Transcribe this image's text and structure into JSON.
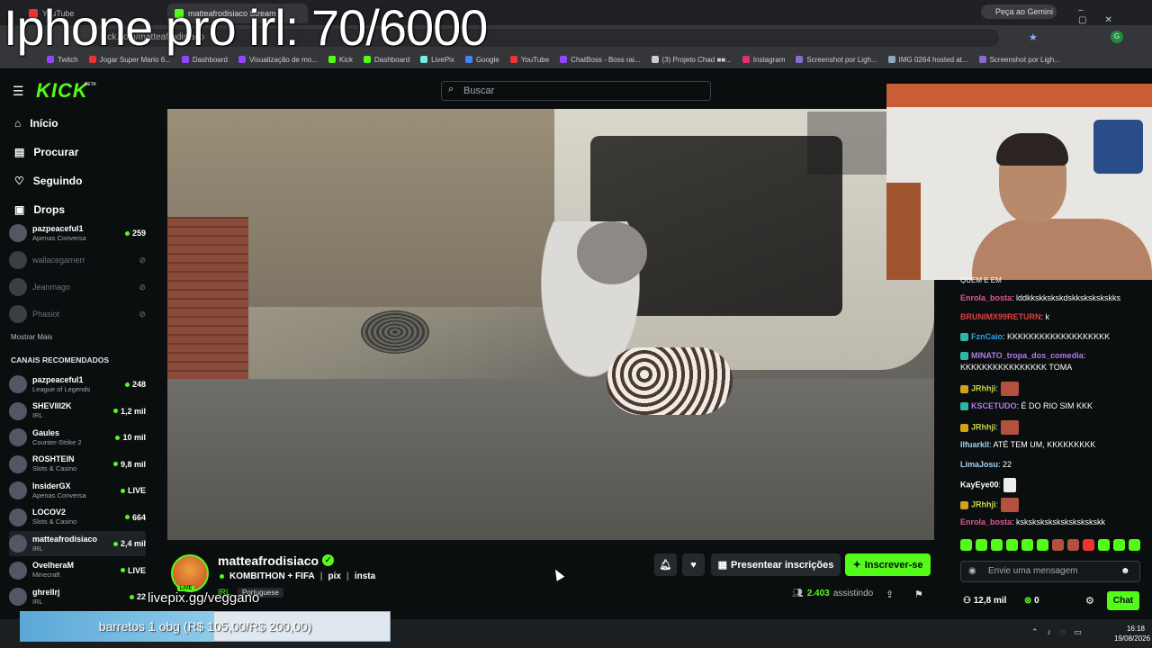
{
  "overlay": {
    "title": "Iphone pro irl: 70/6000",
    "livepix": "livepix.gg/veggano",
    "goal": "barretos 1 obg (R$ 105,00/R$ 200,00)",
    "goal_progress": 0.525
  },
  "browser": {
    "tabs": [
      {
        "label": "YouTube"
      },
      {
        "label": "matteafrodisiaco Stream"
      }
    ],
    "gemini": "Peça ao Gemini",
    "url": "kick.com/matteafrodisiaco",
    "bookmarks": [
      "Twitch",
      "Jogar Super Mario 6...",
      "Dashboard",
      "Visualização de mo...",
      "Kick",
      "Dashboard",
      "LivePix",
      "Google",
      "YouTube",
      "ChatBoss - Boss rai...",
      "(3) Projeto Chad ■■...",
      "Instagram",
      "Screenshot por Ligh...",
      "IMG 0264 hosted at...",
      "Screenshot por Ligh..."
    ]
  },
  "kick": {
    "logo": "KICK",
    "beta": "BETA",
    "search_placeholder": "Buscar",
    "nav": [
      "Início",
      "Procurar",
      "Seguindo",
      "Drops"
    ],
    "following": [
      {
        "name": "pazpeaceful1",
        "sub": "Apenas Conversa",
        "viewers": "259",
        "online": true
      },
      {
        "name": "wallacegamerr",
        "sub": "",
        "viewers": "",
        "online": false
      },
      {
        "name": "Jeanmago",
        "sub": "",
        "viewers": "",
        "online": false
      },
      {
        "name": "Phasiot",
        "sub": "",
        "viewers": "",
        "online": false
      }
    ],
    "show_more": "Mostrar Mais",
    "recommended_title": "CANAIS RECOMENDADOS",
    "recommended": [
      {
        "name": "pazpeaceful1",
        "sub": "League of Legends",
        "viewers": "248"
      },
      {
        "name": "SHEVIII2K",
        "sub": "IRL",
        "viewers": "1,2 mil"
      },
      {
        "name": "Gaules",
        "sub": "Counter-Strike 2",
        "viewers": "10 mil"
      },
      {
        "name": "ROSHTEIN",
        "sub": "Slots & Casino",
        "viewers": "9,8 mil"
      },
      {
        "name": "InsiderGX",
        "sub": "Apenas Conversa",
        "viewers": "LIVE"
      },
      {
        "name": "LOCOV2",
        "sub": "Slots & Casino",
        "viewers": "664"
      },
      {
        "name": "matteafrodisiaco",
        "sub": "IRL",
        "viewers": "2,4 mil"
      },
      {
        "name": "OvelheraM",
        "sub": "Minecraft",
        "viewers": "LIVE"
      },
      {
        "name": "ghrellrj",
        "sub": "IRL",
        "viewers": "22"
      }
    ],
    "stream": {
      "name": "matteafrodisiaco",
      "title_parts": [
        "KOMBITHON + FIFA",
        "pix",
        "insta"
      ],
      "category": "IRL",
      "language": "Portuguese",
      "live": "LIVE",
      "gift_label": "Presentear inscrições",
      "subscribe_label": "Inscrever-se",
      "viewers": "2.403",
      "viewers_label": "assistindo"
    },
    "chat": {
      "partial_top": "QUEM E EM",
      "messages": [
        {
          "user": "Enrola_bosta",
          "text": "lddkkskkskskdskkskskskskks",
          "color": "#e0579b"
        },
        {
          "user": "BRUNIMX99RETURN",
          "text": "k",
          "color": "#e04040"
        },
        {
          "user": "FznCaio",
          "text": "KKKKKKKKKKKKKKKKKKK",
          "color": "#2aa4e8"
        },
        {
          "user": "MINATO_tropa_dos_comedia",
          "text": "KKKKKKKKKKKKKKKK TOMA",
          "color": "#b07ae8"
        },
        {
          "user": "JRhhji",
          "text": "",
          "color": "#c9d64a"
        },
        {
          "user": "KSCETUDO",
          "text": "É DO RIO SIM KKK",
          "color": "#b07ae8"
        },
        {
          "user": "JRhhji",
          "text": "",
          "color": "#c9d64a"
        },
        {
          "user": "Ilfuarkll",
          "text": "ATÉ TEM UM, KKKKKKKKK",
          "color": "#9fd3f0"
        },
        {
          "user": "LimaJosu",
          "text": "22",
          "color": "#9fd3f0"
        },
        {
          "user": "KayEye00",
          "text": "",
          "color": "#ffffff"
        },
        {
          "user": "JRhhji",
          "text": "",
          "color": "#c9d64a"
        },
        {
          "user": "Enrola_bosta",
          "text": "kskskskskskskskskskskk",
          "color": "#e0579b"
        }
      ],
      "input_placeholder": "Envie uma mensagem",
      "followers": "12,8 mil",
      "points": "0",
      "send_label": "Chat"
    }
  },
  "taskbar": {
    "time": "16:18",
    "date": "19/08/2026"
  },
  "colors": {
    "accent": "#53fc18",
    "bg": "#0b0e0f"
  }
}
